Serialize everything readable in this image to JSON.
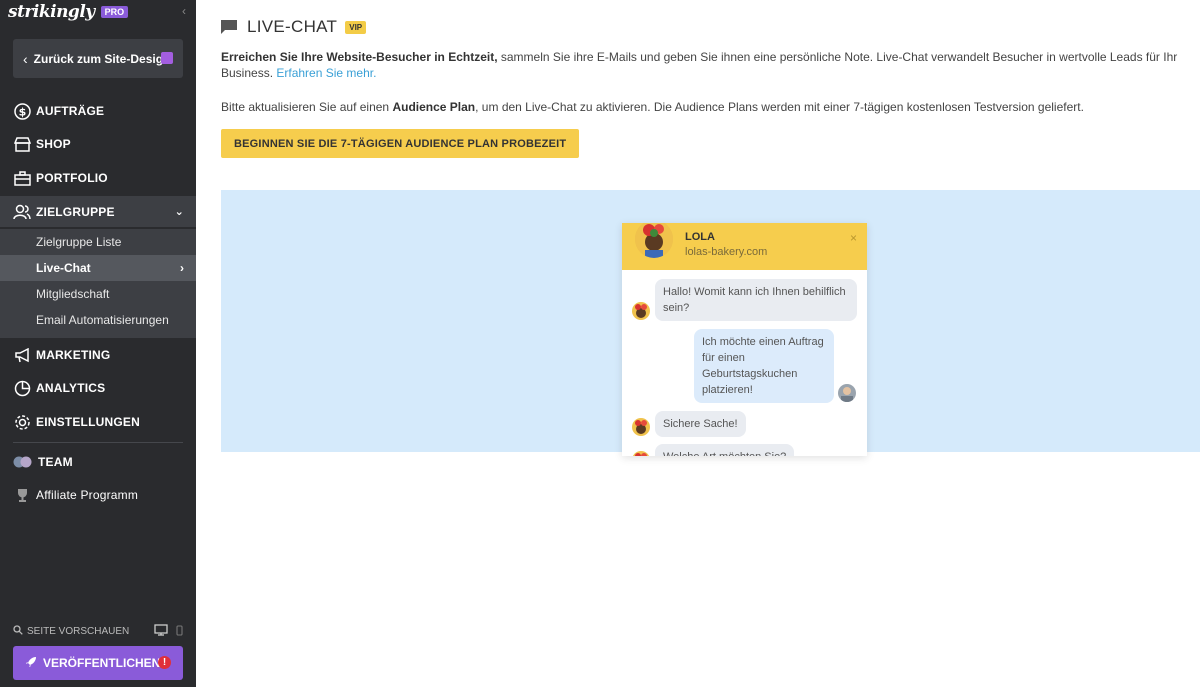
{
  "sidebar": {
    "logo": "strikingly",
    "pro_badge": "PRO",
    "back_label": "Zurück zum Site-Design",
    "nav": {
      "orders": "AUFTRÄGE",
      "shop": "SHOP",
      "portfolio": "PORTFOLIO",
      "audience": "ZIELGRUPPE",
      "marketing": "MARKETING",
      "analytics": "ANALYTICS",
      "settings": "EINSTELLUNGEN",
      "team": "TEAM",
      "affiliate": "Affiliate Programm"
    },
    "audience_sub": {
      "list": "Zielgruppe Liste",
      "live_chat": "Live-Chat",
      "membership": "Mitgliedschaft",
      "email_automation": "Email Automatisierungen"
    },
    "preview_label": "SEITE VORSCHAUEN",
    "publish_label": "VERÖFFENTLICHEN",
    "publish_warning": "!"
  },
  "main": {
    "title": "LIVE-CHAT",
    "vip_badge": "VIP",
    "intro_bold": "Erreichen Sie Ihre Website-Besucher in Echtzeit,",
    "intro_rest": " sammeln Sie ihre E-Mails und geben Sie ihnen eine persönliche Note. Live-Chat verwandelt Besucher in wertvolle Leads für Ihr Business.",
    "learn_more": "Erfahren Sie mehr.",
    "upgrade_pre": "Bitte aktualisieren Sie auf einen ",
    "upgrade_bold": "Audience Plan",
    "upgrade_post": ", um den Live-Chat zu aktivieren. Die Audience Plans werden mit einer 7-tägigen kostenlosen Testversion geliefert.",
    "cta_label": "BEGINNEN SIE DIE 7-TÄGIGEN AUDIENCE PLAN PROBEZEIT"
  },
  "chat_widget": {
    "agent_name": "LOLA",
    "agent_site": "lolas-bakery.com",
    "close": "×",
    "messages": [
      {
        "from": "agent",
        "text": "Hallo! Womit kann ich Ihnen behilflich sein?"
      },
      {
        "from": "visitor",
        "text": "Ich möchte einen Auftrag für einen Geburtstagskuchen platzieren!"
      },
      {
        "from": "agent",
        "text": "Sichere Sache!"
      },
      {
        "from": "agent",
        "text": "Welche Art möchten Sie?"
      }
    ]
  },
  "colors": {
    "sidebar_bg": "#2a2b2e",
    "accent_purple": "#8a5bd9",
    "accent_yellow": "#f6cd4d",
    "link_blue": "#3aa0d6",
    "preview_bg": "#d5eafb"
  }
}
